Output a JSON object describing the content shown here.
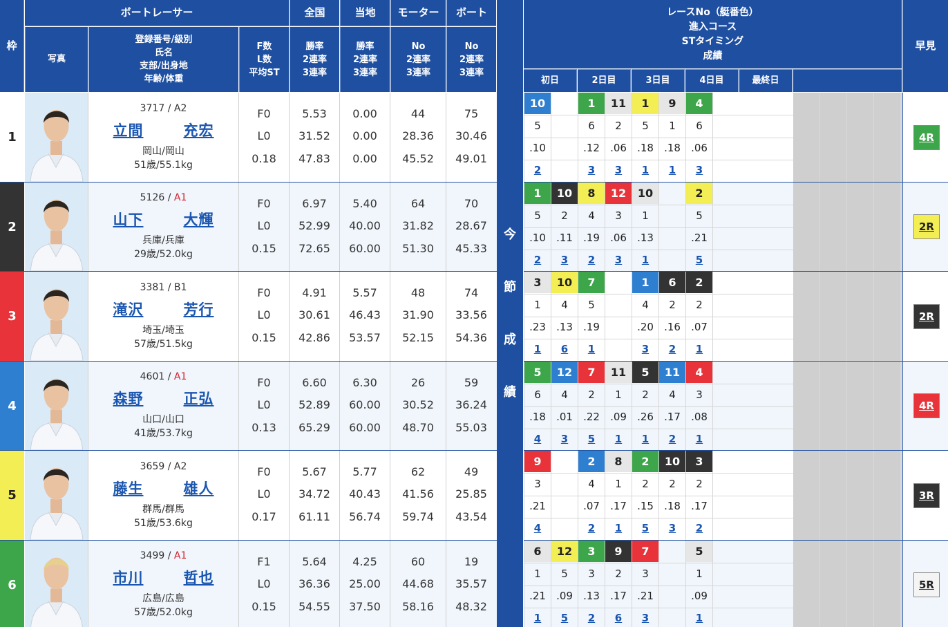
{
  "header": {
    "frame": "枠",
    "boat_racer": "ボートレーサー",
    "photo": "写真",
    "info": [
      "登録番号/級別",
      "氏名",
      "支部/出身地",
      "年齢/体重"
    ],
    "fl": [
      "F数",
      "L数",
      "平均ST"
    ],
    "all": "全国",
    "all_sub": [
      "勝率",
      "2連率",
      "3連率"
    ],
    "local": "当地",
    "local_sub": [
      "勝率",
      "2連率",
      "3連率"
    ],
    "motor": "モーター",
    "motor_sub": [
      "No",
      "2連率",
      "3連率"
    ],
    "boat": "ボート",
    "boat_sub": [
      "No",
      "2連率",
      "3連率"
    ],
    "series": [
      "レースNo（艇番色）",
      "進入コース",
      "STタイミング",
      "成績"
    ],
    "days": [
      "初日",
      "2日目",
      "3日目",
      "4日目",
      "最終日"
    ],
    "early": "早見",
    "sideband": [
      "今",
      "節",
      "成",
      "績"
    ]
  },
  "colors": {
    "header_bg": "#1e4fa0",
    "frame": [
      "#ffffff",
      "#333333",
      "#e8333b",
      "#2f7fd1",
      "#f4ee55",
      "#3da54a"
    ],
    "frame_text": [
      "#222222",
      "#ffffff",
      "#ffffff",
      "#ffffff",
      "#222222",
      "#ffffff"
    ],
    "row_bg": [
      "#ffffff",
      "#f0f6fc"
    ]
  },
  "racers": [
    {
      "frame": "1",
      "reg": "3717",
      "cls": "A2",
      "name_family": "立間",
      "name_given": "充宏",
      "branch": "岡山/岡山",
      "age_weight": "51歳/55.1kg",
      "f": "F0",
      "l": "L0",
      "st": "0.18",
      "all": [
        "5.53",
        "31.52",
        "47.83"
      ],
      "local": [
        "0.00",
        "0.00",
        "0.00"
      ],
      "motor": [
        "44",
        "28.36",
        "45.52"
      ],
      "boat": [
        "75",
        "30.46",
        "49.01"
      ],
      "results": [
        {
          "race": "10",
          "color": 3,
          "course": "5",
          "st": ".10",
          "rank": "2"
        },
        null,
        {
          "race": "1",
          "color": 5,
          "course": "6",
          "st": ".12",
          "rank": "3"
        },
        {
          "race": "11",
          "color": 0,
          "course": "2",
          "st": ".06",
          "rank": "3"
        },
        {
          "race": "1",
          "color": 4,
          "course": "5",
          "st": ".18",
          "rank": "1"
        },
        {
          "race": "9",
          "color": 0,
          "course": "1",
          "st": ".18",
          "rank": "1"
        },
        {
          "race": "4",
          "color": 5,
          "course": "6",
          "st": ".06",
          "rank": "3"
        }
      ],
      "early": "4R",
      "early_color": 5
    },
    {
      "frame": "2",
      "reg": "5126",
      "cls": "A1",
      "name_family": "山下",
      "name_given": "大輝",
      "branch": "兵庫/兵庫",
      "age_weight": "29歳/52.0kg",
      "f": "F0",
      "l": "L0",
      "st": "0.15",
      "all": [
        "6.97",
        "52.99",
        "72.65"
      ],
      "local": [
        "5.40",
        "40.00",
        "60.00"
      ],
      "motor": [
        "64",
        "31.82",
        "51.30"
      ],
      "boat": [
        "70",
        "28.67",
        "45.33"
      ],
      "results": [
        {
          "race": "1",
          "color": 5,
          "course": "5",
          "st": ".10",
          "rank": "2"
        },
        {
          "race": "10",
          "color": 1,
          "course": "2",
          "st": ".11",
          "rank": "3"
        },
        {
          "race": "8",
          "color": 4,
          "course": "4",
          "st": ".19",
          "rank": "2"
        },
        {
          "race": "12",
          "color": 2,
          "course": "3",
          "st": ".06",
          "rank": "3"
        },
        {
          "race": "10",
          "color": 0,
          "course": "1",
          "st": ".13",
          "rank": "1"
        },
        null,
        {
          "race": "2",
          "color": 4,
          "course": "5",
          "st": ".21",
          "rank": "5"
        }
      ],
      "early": "2R",
      "early_color": 4
    },
    {
      "frame": "3",
      "reg": "3381",
      "cls": "B1",
      "name_family": "滝沢",
      "name_given": "芳行",
      "branch": "埼玉/埼玉",
      "age_weight": "57歳/51.5kg",
      "f": "F0",
      "l": "L0",
      "st": "0.15",
      "all": [
        "4.91",
        "30.61",
        "42.86"
      ],
      "local": [
        "5.57",
        "46.43",
        "53.57"
      ],
      "motor": [
        "48",
        "31.90",
        "52.15"
      ],
      "boat": [
        "74",
        "33.56",
        "54.36"
      ],
      "results": [
        {
          "race": "3",
          "color": 0,
          "course": "1",
          "st": ".23",
          "rank": "1"
        },
        {
          "race": "10",
          "color": 4,
          "course": "4",
          "st": ".13",
          "rank": "6"
        },
        {
          "race": "7",
          "color": 5,
          "course": "5",
          "st": ".19",
          "rank": "1"
        },
        null,
        {
          "race": "1",
          "color": 3,
          "course": "4",
          "st": ".20",
          "rank": "3"
        },
        {
          "race": "6",
          "color": 1,
          "course": "2",
          "st": ".16",
          "rank": "2"
        },
        {
          "race": "2",
          "color": 1,
          "course": "2",
          "st": ".07",
          "rank": "1"
        }
      ],
      "early": "2R",
      "early_color": 1
    },
    {
      "frame": "4",
      "reg": "4601",
      "cls": "A1",
      "name_family": "森野",
      "name_given": "正弘",
      "branch": "山口/山口",
      "age_weight": "41歳/53.7kg",
      "f": "F0",
      "l": "L0",
      "st": "0.13",
      "all": [
        "6.60",
        "52.89",
        "65.29"
      ],
      "local": [
        "6.30",
        "60.00",
        "60.00"
      ],
      "motor": [
        "26",
        "30.52",
        "48.70"
      ],
      "boat": [
        "59",
        "36.24",
        "55.03"
      ],
      "results": [
        {
          "race": "5",
          "color": 5,
          "course": "6",
          "st": ".18",
          "rank": "4"
        },
        {
          "race": "12",
          "color": 3,
          "course": "4",
          "st": ".01",
          "rank": "3"
        },
        {
          "race": "7",
          "color": 2,
          "course": "2",
          "st": ".22",
          "rank": "5"
        },
        {
          "race": "11",
          "color": 0,
          "course": "1",
          "st": ".09",
          "rank": "1"
        },
        {
          "race": "5",
          "color": 1,
          "course": "2",
          "st": ".26",
          "rank": "1"
        },
        {
          "race": "11",
          "color": 3,
          "course": "4",
          "st": ".17",
          "rank": "2"
        },
        {
          "race": "4",
          "color": 2,
          "course": "3",
          "st": ".08",
          "rank": "1"
        }
      ],
      "early": "4R",
      "early_color": 2
    },
    {
      "frame": "5",
      "reg": "3659",
      "cls": "A2",
      "name_family": "藤生",
      "name_given": "雄人",
      "branch": "群馬/群馬",
      "age_weight": "51歳/53.6kg",
      "f": "F0",
      "l": "L0",
      "st": "0.17",
      "all": [
        "5.67",
        "34.72",
        "61.11"
      ],
      "local": [
        "5.77",
        "40.43",
        "56.74"
      ],
      "motor": [
        "62",
        "41.56",
        "59.74"
      ],
      "boat": [
        "49",
        "25.85",
        "43.54"
      ],
      "results": [
        {
          "race": "9",
          "color": 2,
          "course": "3",
          "st": ".21",
          "rank": "4"
        },
        null,
        {
          "race": "2",
          "color": 3,
          "course": "4",
          "st": ".07",
          "rank": "2"
        },
        {
          "race": "8",
          "color": 0,
          "course": "1",
          "st": ".17",
          "rank": "1"
        },
        {
          "race": "2",
          "color": 5,
          "course": "2",
          "st": ".15",
          "rank": "5"
        },
        {
          "race": "10",
          "color": 1,
          "course": "2",
          "st": ".18",
          "rank": "3"
        },
        {
          "race": "3",
          "color": 1,
          "course": "2",
          "st": ".17",
          "rank": "2"
        }
      ],
      "early": "3R",
      "early_color": 1
    },
    {
      "frame": "6",
      "reg": "3499",
      "cls": "A1",
      "name_family": "市川",
      "name_given": "哲也",
      "branch": "広島/広島",
      "age_weight": "57歳/52.0kg",
      "f": "F1",
      "l": "L0",
      "st": "0.15",
      "all": [
        "5.64",
        "36.36",
        "54.55"
      ],
      "local": [
        "4.25",
        "25.00",
        "37.50"
      ],
      "motor": [
        "60",
        "44.68",
        "58.16"
      ],
      "boat": [
        "19",
        "35.57",
        "48.32"
      ],
      "results": [
        {
          "race": "6",
          "color": 0,
          "course": "1",
          "st": ".21",
          "rank": "1"
        },
        {
          "race": "12",
          "color": 4,
          "course": "5",
          "st": ".09",
          "rank": "5"
        },
        {
          "race": "3",
          "color": 5,
          "course": "3",
          "st": ".13",
          "rank": "2"
        },
        {
          "race": "9",
          "color": 1,
          "course": "2",
          "st": ".17",
          "rank": "6"
        },
        {
          "race": "7",
          "color": 2,
          "course": "3",
          "st": ".21",
          "rank": "3"
        },
        null,
        {
          "race": "5",
          "color": 0,
          "course": "1",
          "st": ".09",
          "rank": "1"
        }
      ],
      "early": "5R",
      "early_color": 0
    }
  ]
}
